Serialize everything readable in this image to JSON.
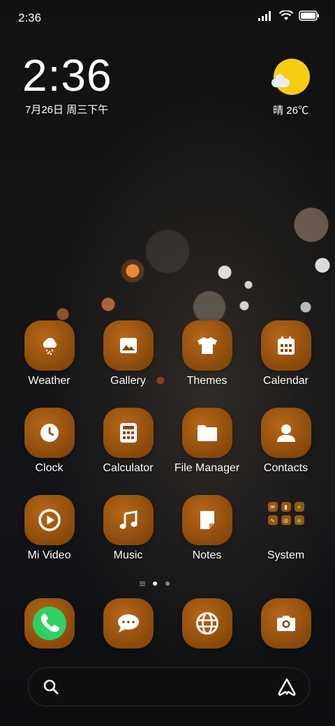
{
  "status_bar": {
    "time": "2:36"
  },
  "widget": {
    "time": "2:36",
    "date": "7月26日 周三下午",
    "weather": "晴 26℃",
    "weather_icon": "sunny-partly-cloudy-icon"
  },
  "apps": [
    {
      "label": "Weather",
      "icon": "weather-icon"
    },
    {
      "label": "Gallery",
      "icon": "gallery-icon"
    },
    {
      "label": "Themes",
      "icon": "themes-icon"
    },
    {
      "label": "Calendar",
      "icon": "calendar-icon"
    },
    {
      "label": "Clock",
      "icon": "clock-icon"
    },
    {
      "label": "Calculator",
      "icon": "calculator-icon"
    },
    {
      "label": "File Manager",
      "icon": "folder-icon"
    },
    {
      "label": "Contacts",
      "icon": "contacts-icon"
    },
    {
      "label": "Mi Video",
      "icon": "play-icon"
    },
    {
      "label": "Music",
      "icon": "music-icon"
    },
    {
      "label": "Notes",
      "icon": "notes-icon"
    },
    {
      "label": "System",
      "icon": "system-folder-icon"
    }
  ],
  "dock": [
    {
      "name": "phone",
      "icon": "phone-icon"
    },
    {
      "name": "messages",
      "icon": "messages-icon"
    },
    {
      "name": "browser",
      "icon": "globe-icon"
    },
    {
      "name": "camera",
      "icon": "camera-icon"
    }
  ],
  "page_indicator": {
    "pages": 2,
    "current": 1
  },
  "colors": {
    "icon_tile": "#8a4a0c",
    "phone_accent": "#2fd163",
    "weather_sun": "#f7cc13"
  }
}
